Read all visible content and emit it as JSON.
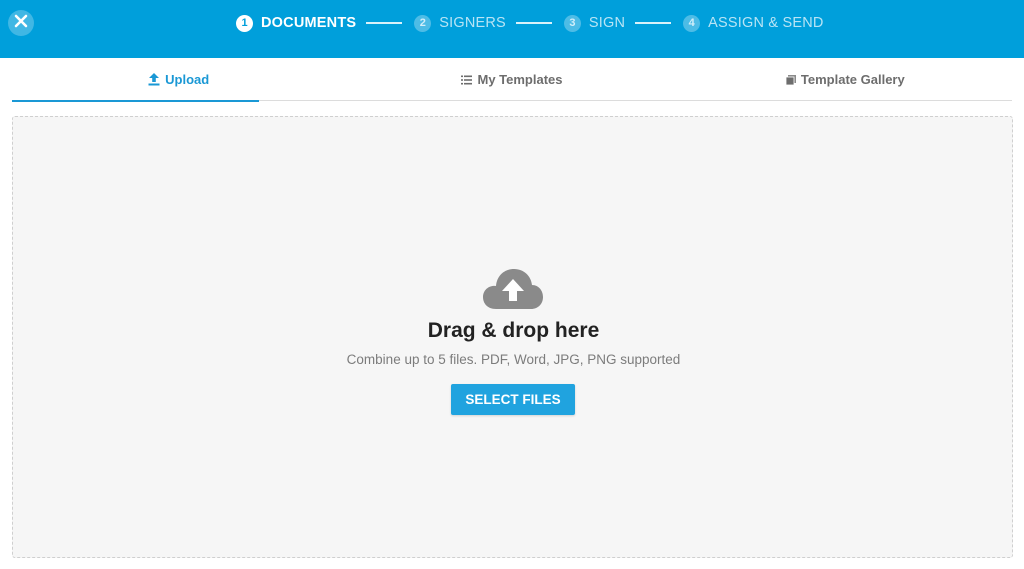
{
  "header": {
    "steps": [
      {
        "number": "1",
        "label": "DOCUMENTS"
      },
      {
        "number": "2",
        "label": "SIGNERS"
      },
      {
        "number": "3",
        "label": "SIGN"
      },
      {
        "number": "4",
        "label": "ASSIGN & SEND"
      }
    ],
    "active_step": 1
  },
  "tabs": [
    {
      "label": "Upload",
      "icon": "upload-icon"
    },
    {
      "label": "My Templates",
      "icon": "list-icon"
    },
    {
      "label": "Template Gallery",
      "icon": "gallery-icon"
    }
  ],
  "dropzone": {
    "icon": "cloud-upload-icon",
    "title": "Drag & drop here",
    "subtitle": "Combine up to 5 files. PDF, Word, JPG, PNG supported",
    "button_label": "SELECT FILES"
  },
  "colors": {
    "brand": "#009fdb",
    "accent": "#1a98d5",
    "button": "#20a3df",
    "dropzone_bg": "#f6f6f6"
  }
}
